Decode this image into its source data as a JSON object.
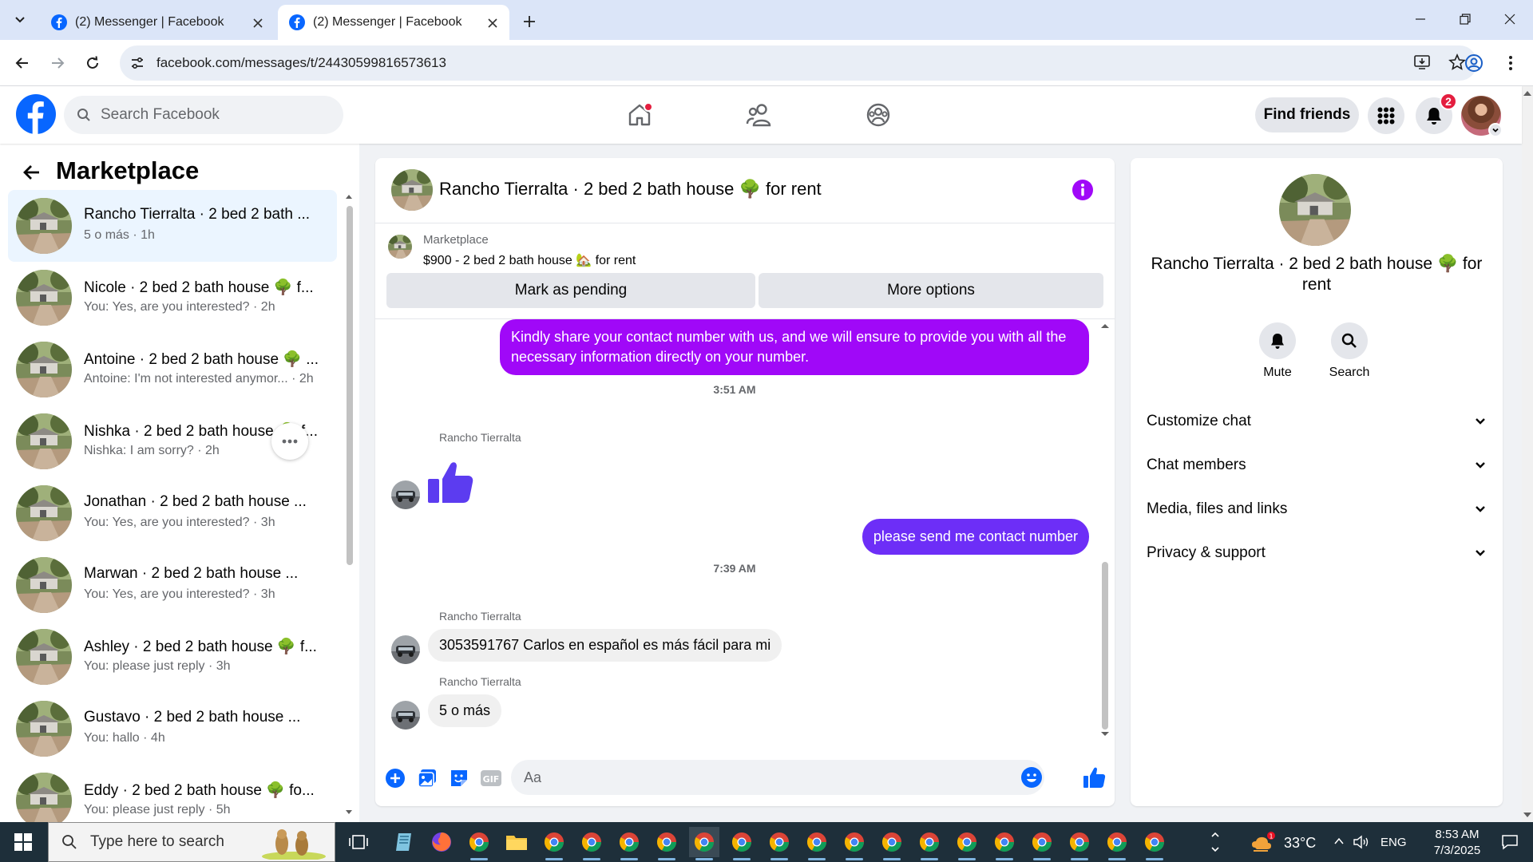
{
  "browser": {
    "tabs": [
      {
        "title": "(2) Messenger | Facebook",
        "active": false
      },
      {
        "title": "(2) Messenger | Facebook",
        "active": true
      }
    ],
    "url": "facebook.com/messages/t/24430599816573613"
  },
  "fb_header": {
    "search_placeholder": "Search Facebook",
    "find_friends_label": "Find friends",
    "notification_count": "2",
    "brand_color": "#0866ff"
  },
  "left_panel": {
    "title": "Marketplace",
    "conversations": [
      {
        "name": "Rancho Tierralta · 2 bed 2 bath ...",
        "preview": "5 o más · 1h",
        "active": true
      },
      {
        "name": "Nicole · 2 bed 2 bath house 🌳 f...",
        "preview": "You: Yes, are you interested? · 2h"
      },
      {
        "name": "Antoine · 2 bed 2 bath house 🌳 ...",
        "preview": "Antoine: I'm not interested anymor... · 2h"
      },
      {
        "name": "Nishka · 2 bed 2 bath house 🌳 f...",
        "preview": "Nishka: I am sorry? · 2h"
      },
      {
        "name": "Jonathan · 2 bed 2 bath house ...",
        "preview": "You: Yes, are you interested? · 3h"
      },
      {
        "name": "Marwan · 2 bed 2 bath house ...",
        "preview": "You: Yes, are you interested? · 3h"
      },
      {
        "name": "Ashley · 2 bed 2 bath house 🌳 f...",
        "preview": "You: please just reply · 3h"
      },
      {
        "name": "Gustavo · 2 bed 2 bath house ...",
        "preview": "You: hallo · 4h"
      },
      {
        "name": "Eddy · 2 bed 2 bath house 🌳 fo...",
        "preview": "You: please just reply · 5h"
      }
    ]
  },
  "chat": {
    "title": "Rancho Tierralta · 2 bed 2 bath house 🌳 for rent",
    "listing": {
      "category": "Marketplace",
      "title": "$900 - 2 bed 2 bath house 🏡 for rent",
      "mark_pending_label": "Mark as pending",
      "more_options_label": "More options"
    },
    "messages": {
      "out_1": "Kindly share your contact number with us, and we will ensure to provide you with all the necessary information directly on your number.",
      "time_1": "3:51 AM",
      "sender_1": "Rancho Tierralta",
      "out_2": "please send me contact number",
      "time_2": "7:39 AM",
      "sender_2": "Rancho Tierralta",
      "in_2": "3053591767 Carlos en español es más fácil para mi",
      "sender_3": "Rancho Tierralta",
      "in_3": "5 o más"
    },
    "composer_placeholder": "Aa",
    "accent_color": "#a008f8"
  },
  "right_panel": {
    "name": "Rancho Tierralta · 2 bed 2 bath house 🌳 for rent",
    "mute_label": "Mute",
    "search_label": "Search",
    "sections": [
      "Customize chat",
      "Chat members",
      "Media, files and links",
      "Privacy & support"
    ]
  },
  "taskbar": {
    "search_placeholder": "Type here to search",
    "temperature": "33°C",
    "language": "ENG",
    "time": "8:53 AM",
    "date": "7/3/2025"
  }
}
